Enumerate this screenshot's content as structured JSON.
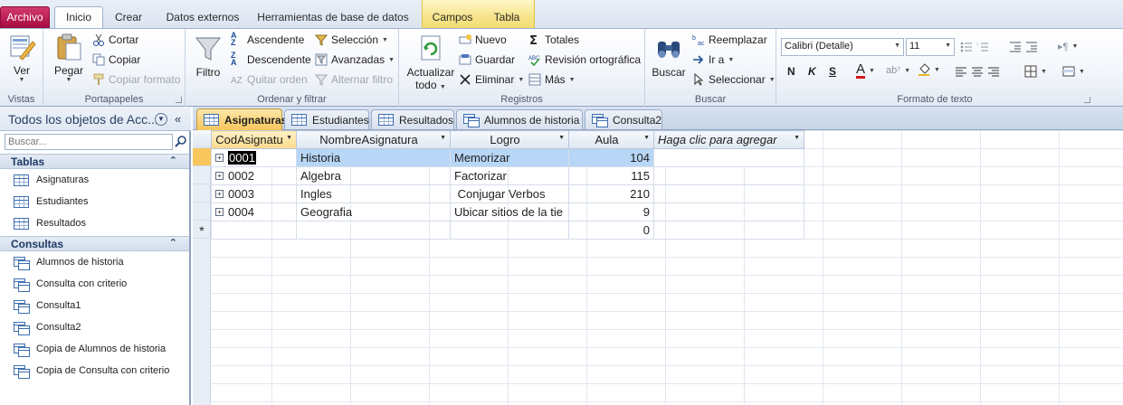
{
  "tabs": {
    "archivo": "Archivo",
    "inicio": "Inicio",
    "crear": "Crear",
    "datos_externos": "Datos externos",
    "herramientas": "Herramientas de base de datos",
    "campos": "Campos",
    "tabla": "Tabla"
  },
  "ribbon": {
    "vistas": {
      "ver": "Ver",
      "label": "Vistas"
    },
    "portapapeles": {
      "pegar": "Pegar",
      "cortar": "Cortar",
      "copiar": "Copiar",
      "copiar_formato": "Copiar formato",
      "label": "Portapapeles"
    },
    "ordenar": {
      "filtro": "Filtro",
      "ascendente": "Ascendente",
      "descendente": "Descendente",
      "quitar_orden": "Quitar orden",
      "seleccion": "Selección",
      "avanzadas": "Avanzadas",
      "alternar_filtro": "Alternar filtro",
      "label": "Ordenar y filtrar"
    },
    "registros": {
      "actualizar": "Actualizar",
      "todo": "todo",
      "nuevo": "Nuevo",
      "guardar": "Guardar",
      "eliminar": "Eliminar",
      "totales": "Totales",
      "revision": "Revisión ortográfica",
      "mas": "Más",
      "label": "Registros"
    },
    "buscar": {
      "buscar": "Buscar",
      "reemplazar": "Reemplazar",
      "ir_a": "Ir a",
      "seleccionar": "Seleccionar",
      "label": "Buscar"
    },
    "formato": {
      "font": "Calibri (Detalle)",
      "size": "11",
      "bold": "N",
      "italic": "K",
      "underline": "S",
      "font_color_letter": "A",
      "label": "Formato de texto"
    }
  },
  "nav": {
    "title": "Todos los objetos de Acc...",
    "search_placeholder": "Buscar...",
    "sections": [
      {
        "title": "Tablas",
        "items": [
          "Asignaturas",
          "Estudiantes",
          "Resultados"
        ]
      },
      {
        "title": "Consultas",
        "items": [
          "Alumnos de historia",
          "Consulta con criterio",
          "Consulta1",
          "Consulta2",
          "Copia de Alumnos de historia",
          "Copia de Consulta con criterio"
        ]
      }
    ]
  },
  "doc_tabs": [
    "Asignaturas",
    "Estudiantes",
    "Resultados",
    "Alumnos de historia",
    "Consulta2"
  ],
  "datasheet": {
    "columns": [
      "CodAsignatu",
      "NombreAsignatura",
      "Logro",
      "Aula",
      "Haga clic para agregar"
    ],
    "rows": [
      {
        "cod": "0001",
        "nombre": "Historia",
        "logro": "Memorizar",
        "aula": "104"
      },
      {
        "cod": "0002",
        "nombre": "Algebra",
        "logro": "Factorizar",
        "aula": "115"
      },
      {
        "cod": "0003",
        "nombre": "Ingles",
        "logro": " Conjugar Verbos",
        "aula": "210"
      },
      {
        "cod": "0004",
        "nombre": "Geografia",
        "logro": "Ubicar sitios de la tie",
        "aula": "9"
      }
    ],
    "new_row_aula": "0",
    "new_row_marker": "*"
  }
}
